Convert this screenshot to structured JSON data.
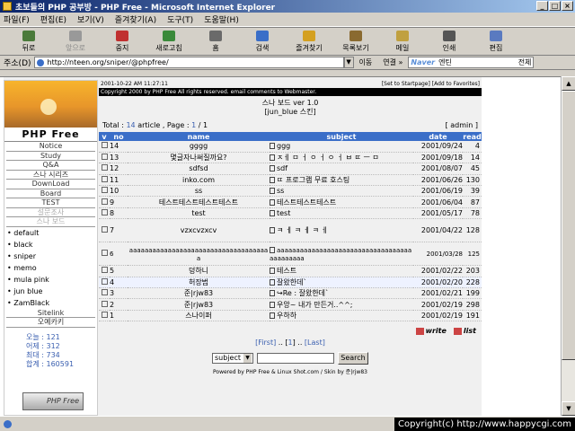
{
  "window": {
    "title": "초보들의 PHP 공부방 - PHP Free - Microsoft Internet Explorer",
    "btn_min": "_",
    "btn_max": "□",
    "btn_close": "×"
  },
  "menu": [
    "파일(F)",
    "편집(E)",
    "보기(V)",
    "즐겨찾기(A)",
    "도구(T)",
    "도움말(H)"
  ],
  "toolbar": [
    {
      "label": "뒤로",
      "color": "#4a7a3a",
      "disabled": false
    },
    {
      "label": "앞으로",
      "color": "#999999",
      "disabled": true
    },
    {
      "label": "중지",
      "color": "#c03030",
      "disabled": false
    },
    {
      "label": "새로고침",
      "color": "#3a8a3a",
      "disabled": false
    },
    {
      "label": "홈",
      "color": "#6a6a6a",
      "disabled": false
    },
    {
      "label": "검색",
      "color": "#3a6ec8",
      "disabled": false
    },
    {
      "label": "즐겨찾기",
      "color": "#d4a020",
      "disabled": false
    },
    {
      "label": "목록보기",
      "color": "#8a6a30",
      "disabled": false
    },
    {
      "label": "메일",
      "color": "#c0a040",
      "disabled": false
    },
    {
      "label": "인쇄",
      "color": "#555555",
      "disabled": false
    },
    {
      "label": "편집",
      "color": "#5a7ac0",
      "disabled": false
    }
  ],
  "address": {
    "label": "주소(D)",
    "url": "http://nteen.org/sniper/@phpfree/",
    "dropdown": "▼",
    "go": "이동",
    "links": "연결 »",
    "naver_logo": "Naver",
    "naver_text": "엔틴",
    "naver_all": "전체"
  },
  "sidebar": {
    "brand": "PHP Free",
    "menu": [
      {
        "label": "Notice",
        "grey": false
      },
      {
        "label": "Study",
        "grey": false
      },
      {
        "label": "Q&A",
        "grey": false
      },
      {
        "label": "스나 시리즈",
        "grey": false
      },
      {
        "label": "DownLoad",
        "grey": false
      },
      {
        "label": "Board",
        "grey": false
      },
      {
        "label": "TEST",
        "grey": false
      },
      {
        "label": "설문조사",
        "grey": true
      },
      {
        "label": "스나 보드",
        "grey": true
      }
    ],
    "skins": [
      "default",
      "black",
      "sniper",
      "memo",
      "mula pink",
      "jun blue",
      "ZamBlack"
    ],
    "bottom_menu": [
      "Sitelink",
      "오예카키"
    ],
    "stats": [
      "오늘 : 121",
      "어제 : 312",
      "최대 : 734",
      "합계 : 160591"
    ],
    "button": "PHP Free"
  },
  "main": {
    "date": "2001-10-22 AM 11:27:11",
    "links": "[Set to Startpage] [Add to Favorites]",
    "bar": "Copyright 2000 by PHP Free All rights reserved. email comments to Webmaster.",
    "board_title": "스나 보드 ver 1.0",
    "skin": "[jun_blue 스킨]",
    "total_label": "Total : ",
    "total": "14",
    "article": " article , Page : ",
    "page": "1",
    "page_of": " / 1",
    "admin": "[ admin ]",
    "headers": [
      "v",
      "no",
      "name",
      "subject",
      "date",
      "read"
    ],
    "rows": [
      {
        "no": "14",
        "name": "gggg",
        "subject": "ggg",
        "date": "2001/09/24",
        "read": "4"
      },
      {
        "no": "13",
        "name": "몇글자나써질까요?",
        "subject": "ㅈㅔ ㅁ ㅓ ㅇ ㅓ ㅇ ㅓ ㅂ ㄸ ㅡ ㅁ",
        "date": "2001/09/18",
        "read": "14"
      },
      {
        "no": "12",
        "name": "sdfsd",
        "subject": "sdf",
        "date": "2001/08/07",
        "read": "45"
      },
      {
        "no": "11",
        "name": "inko.com",
        "subject": "ㄸ 프로그램 무료 호스팅",
        "date": "2001/06/26",
        "read": "130"
      },
      {
        "no": "10",
        "name": "ss",
        "subject": "ss",
        "date": "2001/06/19",
        "read": "39"
      },
      {
        "no": "9",
        "name": "테스트테스트테스트테스트",
        "subject": "테스트테스트테스트",
        "date": "2001/06/04",
        "read": "87"
      },
      {
        "no": "8",
        "name": "test",
        "subject": "test",
        "date": "2001/05/17",
        "read": "78"
      },
      {
        "no": "7",
        "name": "vzxcvzxcv",
        "subject": "ㅋ ㅔ ㅋ ㅔ ㅋ ㅔ",
        "date": "2001/04/22",
        "read": "128"
      },
      {
        "no": "6",
        "name": "aaaaaaaaaaaaaaaaaaaaaaaaaaaaaaaaaaaaa",
        "subject": "aaaaaaaaaaaaaaaaaaaaaaaaaaaaaaaaaaaaaaaaaaaa",
        "date": "2001/03/28",
        "read": "125"
      },
      {
        "no": "5",
        "name": "덩하니",
        "subject": "테스트",
        "date": "2001/02/22",
        "read": "203"
      },
      {
        "no": "4",
        "name": "허장범",
        "subject": "잘왔한데`",
        "date": "2001/02/20",
        "read": "228"
      },
      {
        "no": "3",
        "name": "준|rjw83",
        "subject": "↪Re : 잘왔한데`",
        "date": "2001/02/21",
        "read": "199"
      },
      {
        "no": "2",
        "name": "준|rjw83",
        "subject": "우앙~ 내가 만든거..^^;",
        "date": "2001/02/19",
        "read": "298"
      },
      {
        "no": "1",
        "name": "스나이퍼",
        "subject": "우하하",
        "date": "2001/02/19",
        "read": "191"
      }
    ],
    "write": "write",
    "list": "list",
    "pager_first": "[First]",
    "pager_mid": " .. [",
    "pager_page": "1",
    "pager_end": "] .. ",
    "pager_last": "[Last]",
    "search_select": "subject",
    "search_btn": "Search",
    "powered": "Powered by PHP Free & Linux Shot.com / Skin by 준|rjw83"
  },
  "scroll": {
    "up": "▲",
    "down": "▼"
  },
  "copyright": "Copyright(c) http://www.happycgi.com"
}
